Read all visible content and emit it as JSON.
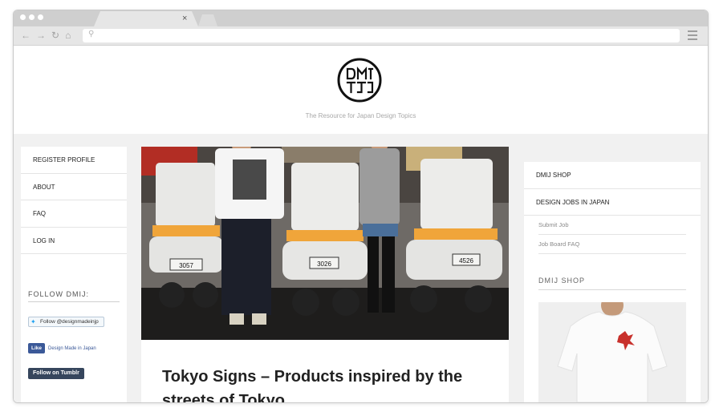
{
  "browser": {
    "tab_close": "×",
    "nav_icons": [
      "back-arrow-icon",
      "forward-arrow-icon",
      "reload-icon",
      "home-icon"
    ],
    "url_placeholder": ""
  },
  "header": {
    "logo_alt": "DMIJ",
    "tagline": "The Resource for Japan Design Topics"
  },
  "left_sidebar": {
    "nav": [
      "REGISTER PROFILE",
      "ABOUT",
      "FAQ",
      "LOG IN"
    ],
    "follow_title": "FOLLOW DMIJ:",
    "twitter_label": "Follow @designmadeinjp",
    "facebook_button": "Like",
    "facebook_label": "Design Made in Japan",
    "tumblr_label": "Follow on Tumblr"
  },
  "main": {
    "hero_description": "Tokyo scooters",
    "scooter_plates": [
      "3057",
      "3026",
      "4526"
    ],
    "article_title": "Tokyo Signs – Products inspired by the streets of Tokyo"
  },
  "right_sidebar": {
    "nav": [
      "DMIJ SHOP",
      "DESIGN JOBS IN JAPAN"
    ],
    "sub_nav": [
      "Submit Job",
      "Job Board FAQ"
    ],
    "shop_title": "DMIJ SHOP"
  },
  "colors": {
    "page_bg": "#f1f1f1",
    "twitter_blue": "#1da1f2",
    "facebook_blue": "#3b5998",
    "tumblr_navy": "#36465d"
  }
}
